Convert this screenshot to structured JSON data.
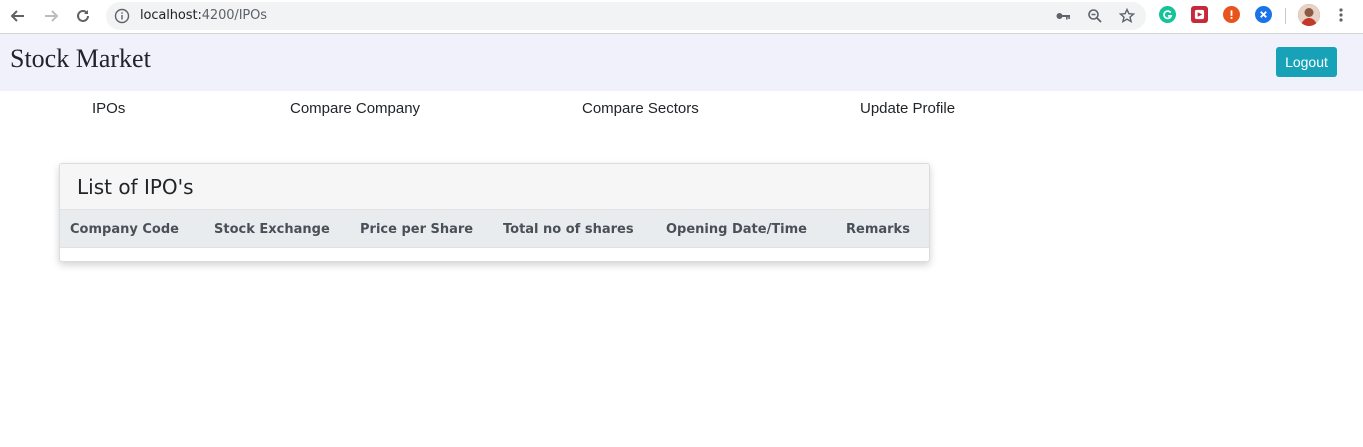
{
  "browser": {
    "url_host": "localhost:",
    "url_rest": "4200/IPOs",
    "icons": [
      "back-arrow-icon",
      "forward-arrow-icon",
      "reload-icon",
      "info-icon",
      "key-icon",
      "zoom-out-icon",
      "star-icon",
      "grammarly-extension-icon",
      "media-extension-icon",
      "alert-extension-icon",
      "blue-extension-icon",
      "profile-avatar",
      "more-menu-icon"
    ]
  },
  "header": {
    "brand": "Stock Market",
    "logout_label": "Logout",
    "logout_color": "#17a2b8",
    "background": "#f1f1fb"
  },
  "nav": {
    "items": [
      {
        "label": "IPOs"
      },
      {
        "label": "Compare Company"
      },
      {
        "label": "Compare Sectors"
      },
      {
        "label": "Update Profile"
      }
    ]
  },
  "ipo_card": {
    "title": "List of IPO's",
    "columns": [
      "Company Code",
      "Stock Exchange",
      "Price per Share",
      "Total no of shares",
      "Opening Date/Time",
      "Remarks"
    ],
    "rows": []
  }
}
